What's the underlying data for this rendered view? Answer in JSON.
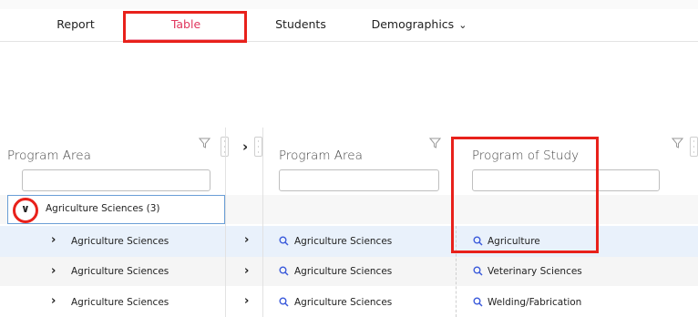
{
  "tabs": {
    "report": "Report",
    "table": "Table",
    "students": "Students",
    "demographics": "Demographics"
  },
  "columns": {
    "col1_header": "Program Area",
    "col2_header": "Program Area",
    "col3_header": "Program of Study"
  },
  "group": {
    "label": "Agriculture Sciences (3)"
  },
  "rows": [
    {
      "area": "Agriculture Sciences",
      "area2": "Agriculture Sciences",
      "study": "Agriculture"
    },
    {
      "area": "Agriculture Sciences",
      "area2": "Agriculture Sciences",
      "study": "Veterinary Sciences"
    },
    {
      "area": "Agriculture Sciences",
      "area2": "Agriculture Sciences",
      "study": "Welding/Fabrication"
    }
  ],
  "colors": {
    "active_tab": "#e0365d",
    "highlight": "#e8211b",
    "selected_row": "#e9f1fb",
    "search_icon": "#3b5bdb"
  }
}
